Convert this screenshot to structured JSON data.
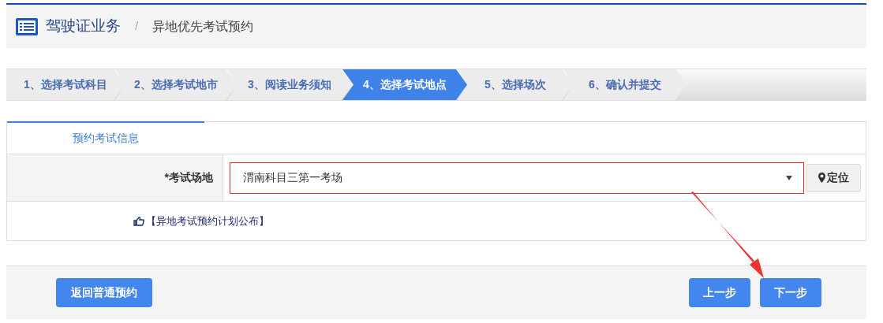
{
  "breadcrumb": {
    "section": "驾驶证业务",
    "separator": "/",
    "page": "异地优先考试预约"
  },
  "steps": [
    {
      "label": "1、选择考试科目",
      "selected": false
    },
    {
      "label": "2、选择考试地市",
      "selected": false
    },
    {
      "label": "3、阅读业务须知",
      "selected": false
    },
    {
      "label": "4、选择考试地点",
      "selected": true
    },
    {
      "label": "5、选择场次",
      "selected": false
    },
    {
      "label": "6、确认并提交",
      "selected": false
    }
  ],
  "panel": {
    "tab": "预约考试信息",
    "field": {
      "label": "*考试场地",
      "value": "渭南科目三第一考场",
      "locate_button": "定位"
    },
    "link": "【异地考试预约计划公布】"
  },
  "footer": {
    "back_button": "返回普通预约",
    "prev_button": "上一步",
    "next_button": "下一步"
  }
}
